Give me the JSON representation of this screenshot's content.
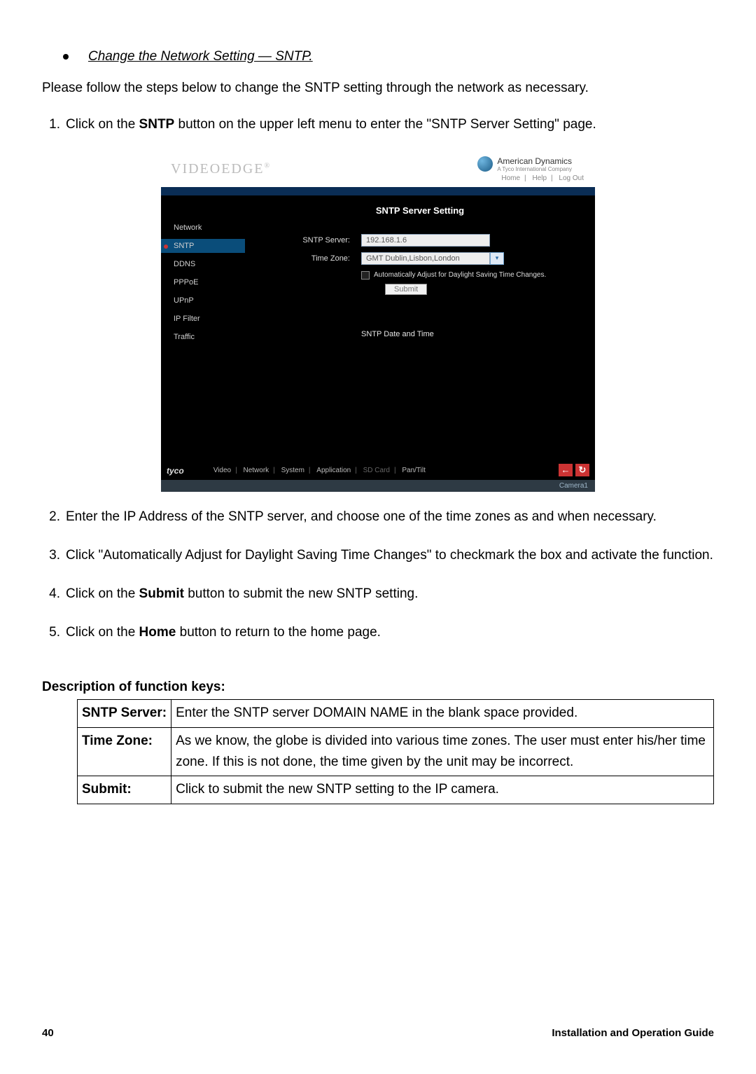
{
  "doc": {
    "section_title": "Change the Network Setting — SNTP.",
    "intro": "Please follow the steps below to change the SNTP setting through the network as necessary.",
    "steps": {
      "s1_pre": "Click on the ",
      "s1_b": "SNTP",
      "s1_post": " button on the upper left menu to enter the \"SNTP Server Setting\" page.",
      "s2": "Enter the IP Address of the SNTP server, and choose one of the time zones as and when necessary.",
      "s3": "Click \"Automatically Adjust for Daylight Saving Time Changes\" to checkmark the box and activate the function.",
      "s4_pre": "Click on the ",
      "s4_b": "Submit",
      "s4_post": " button to submit the new SNTP setting.",
      "s5_pre": "Click on the ",
      "s5_b": "Home",
      "s5_post": " button to return to the home page."
    },
    "keys_heading": "Description of function keys:",
    "table": {
      "r1k": "SNTP Server:",
      "r1v": "Enter the SNTP server DOMAIN NAME in the blank space provided.",
      "r2k": "Time Zone:",
      "r2v": "As we know, the globe is divided into various time zones. The user must enter his/her time zone. If this is not done, the time given by the unit may be incorrect.",
      "r3k": "Submit:",
      "r3v": "Click to submit the new SNTP setting to the IP camera."
    },
    "page_number": "40",
    "guide_title": "Installation and Operation Guide"
  },
  "ui": {
    "logo": "VIDEOEDGE",
    "brand": "American Dynamics",
    "brand_sub": "A Tyco International Company",
    "toplinks": {
      "home": "Home",
      "help": "Help",
      "logout": "Log Out"
    },
    "panel_title": "SNTP Server Setting",
    "sidebar": [
      "Network",
      "SNTP",
      "DDNS",
      "PPPoE",
      "UPnP",
      "IP Filter",
      "Traffic"
    ],
    "labels": {
      "sntp_server": "SNTP Server:",
      "time_zone": "Time Zone:"
    },
    "values": {
      "sntp_server": "192.168.1.6",
      "time_zone": "GMT Dublin,Lisbon,London"
    },
    "checkbox_label": "Automatically Adjust for Daylight Saving Time Changes.",
    "submit": "Submit",
    "sub_section": "SNTP Date and Time",
    "footer": {
      "tyco": "tyco",
      "video": "Video",
      "network": "Network",
      "system": "System",
      "application": "Application",
      "sdcard": "SD Card",
      "pantilt": "Pan/Tilt",
      "camera": "Camera1"
    }
  }
}
